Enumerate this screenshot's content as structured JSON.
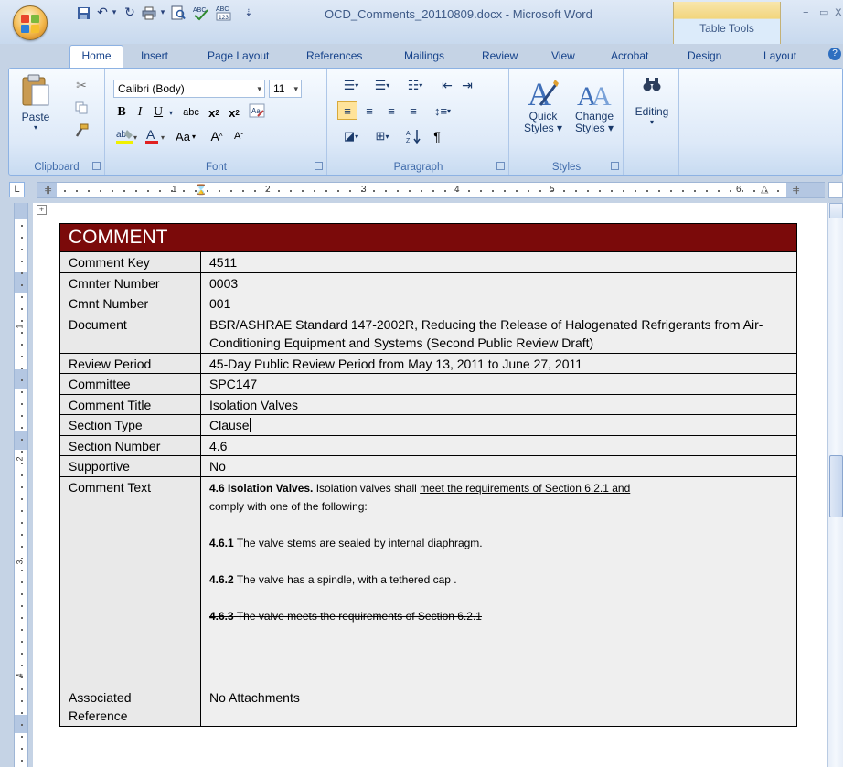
{
  "window": {
    "title": "OCD_Comments_20110809.docx - Microsoft Word",
    "contextual_tab_group": "Table Tools"
  },
  "tabs": [
    "Home",
    "Insert",
    "Page Layout",
    "References",
    "Mailings",
    "Review",
    "View",
    "Acrobat",
    "Design",
    "Layout"
  ],
  "ribbon": {
    "clipboard": {
      "label": "Clipboard",
      "paste": "Paste"
    },
    "font": {
      "label": "Font",
      "font_name": "Calibri (Body)",
      "font_size": "11",
      "change_case": "Aa"
    },
    "paragraph": {
      "label": "Paragraph",
      "show_marks": "¶"
    },
    "styles": {
      "label": "Styles",
      "quick_styles_1": "Quick",
      "quick_styles_2": "Styles",
      "change_styles_1": "Change",
      "change_styles_2": "Styles"
    },
    "editing": {
      "label": "Editing"
    }
  },
  "ruler": {
    "numbers": [
      "1",
      "2",
      "3",
      "4",
      "5",
      "6"
    ]
  },
  "vruler": {
    "numbers": [
      "1",
      "2",
      "3",
      "4"
    ]
  },
  "table": {
    "header": "COMMENT",
    "rows": [
      {
        "label": "Comment Key",
        "value": "4511"
      },
      {
        "label": "Cmnter Number",
        "value": "0003"
      },
      {
        "label": "Cmnt Number",
        "value": "001"
      },
      {
        "label": "Document",
        "value": "BSR/ASHRAE Standard 147-2002R, Reducing the Release of Halogenated Refrigerants from Air-Conditioning Equipment and Systems (Second Public Review Draft)"
      },
      {
        "label": "Review Period",
        "value": "45-Day Public Review Period from May 13, 2011 to June 27, 2011"
      },
      {
        "label": "Committee",
        "value": "SPC147"
      },
      {
        "label": "Comment Title",
        "value": "Isolation Valves"
      },
      {
        "label": "Section Type",
        "value": "Clause"
      },
      {
        "label": "Section Number",
        "value": "4.6"
      },
      {
        "label": "Supportive",
        "value": "No"
      }
    ],
    "comment_text": {
      "label": "Comment Text",
      "p1_bold": "4.6 Isolation Valves.",
      "p1_text": " Isolation valves shall ",
      "p1_underlined": "meet the requirements of Section 6.2.1 and",
      "p1_cont": "comply with one of the following:",
      "p2_bold": "4.6.1",
      "p2_text": " The valve stems are sealed by internal diaphragm.",
      "p3_bold": "4.6.2",
      "p3_text": " The valve has a spindle, with a tethered cap .",
      "p4_bold": "4.6.3",
      "p4_text": " The valve meets the requirements of Section 6.2.1"
    },
    "associated": {
      "label_1": "Associated",
      "label_2": "Reference",
      "value": "No Attachments"
    }
  }
}
